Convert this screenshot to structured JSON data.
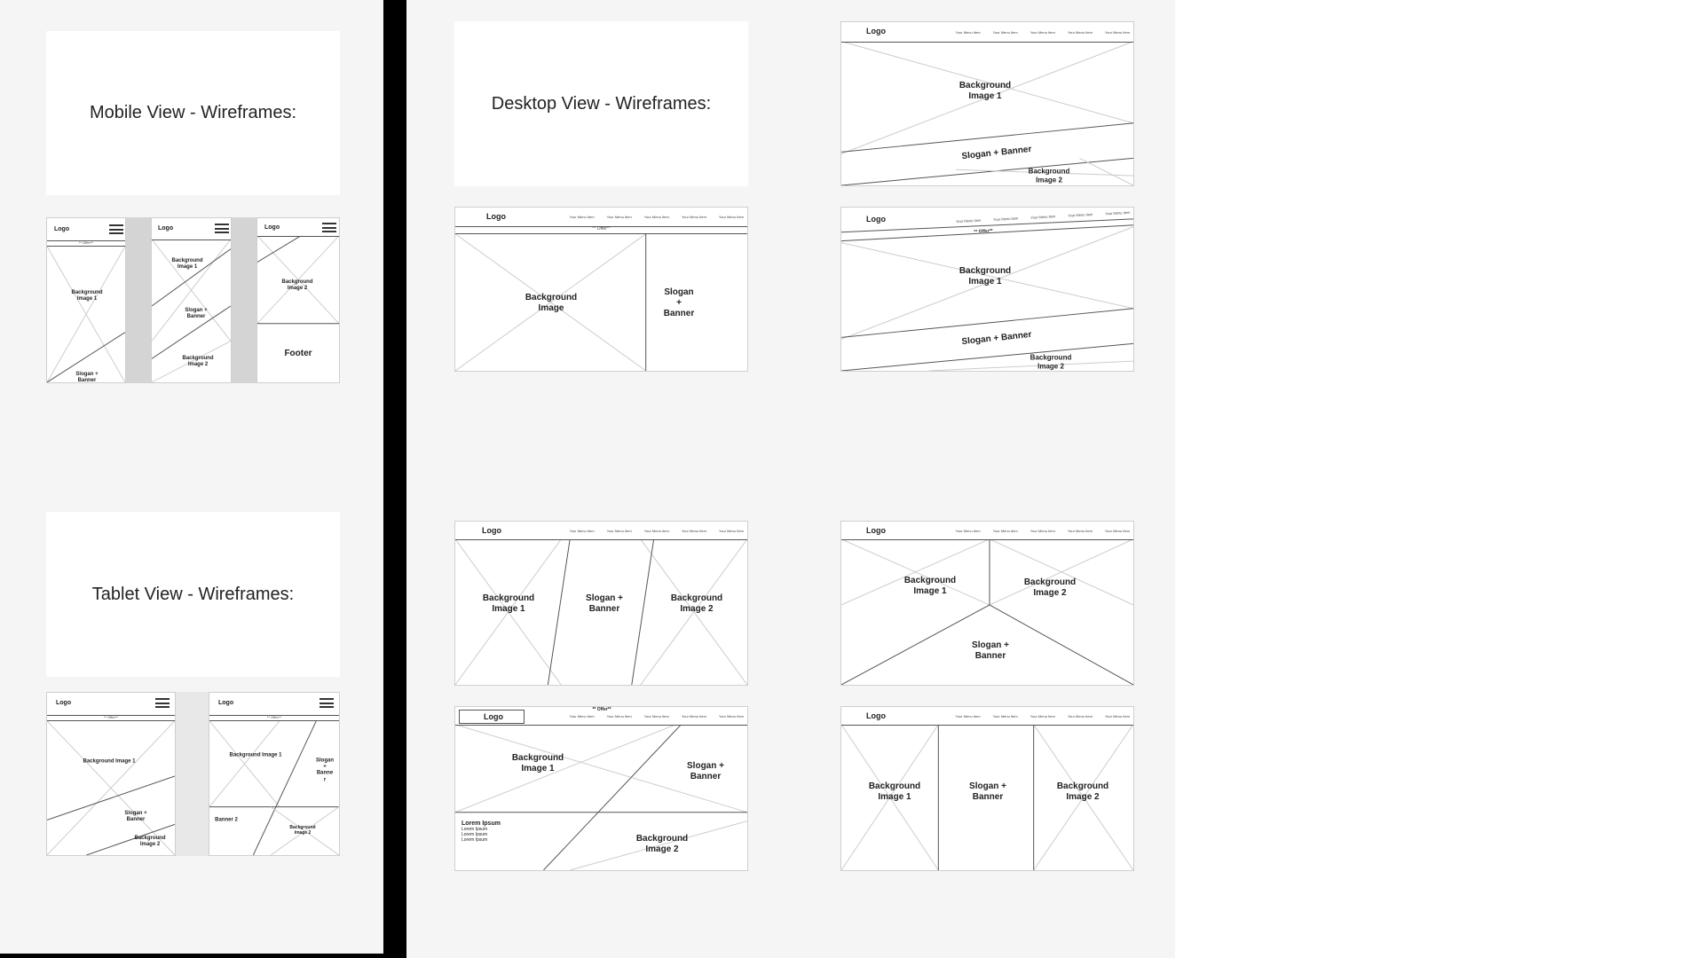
{
  "titles": {
    "mobile": "Mobile View - Wireframes:",
    "desktop": "Desktop View - Wireframes:",
    "tablet": "Tablet View - Wireframes:"
  },
  "common": {
    "logo": "Logo",
    "offer": "** Offer**",
    "menu_item": "Your Menu Item",
    "bg1": "Background Image 1",
    "bg1_two_line": "Background\nImage 1",
    "bg2": "Background Image 2",
    "bg2_two_line": "Background\nImage 2",
    "bg_image": "Background\nImage",
    "slogan_banner": "Slogan + Banner",
    "slogan_banner_two": "Slogan +\nBanner",
    "slogan_banner_stack": "Slogan\n+\nBanner",
    "slogan_banner_narrow": "Slogan\n+\nBanne\nr",
    "footer": "Footer",
    "banner2": "Banner 2",
    "lorem_title": "Lorem Ipsum",
    "lorem_lines": [
      "Lorem Ipsum",
      "Lorem Ipsum",
      "Lorem Ipsum"
    ]
  },
  "colors": {
    "panel_bg": "#f5f5f5",
    "card_bg": "#ffffff",
    "divider": "#000000",
    "wire_line": "#555555",
    "cross_line": "#cccccc",
    "gap_gray": "#d4d4d4"
  }
}
